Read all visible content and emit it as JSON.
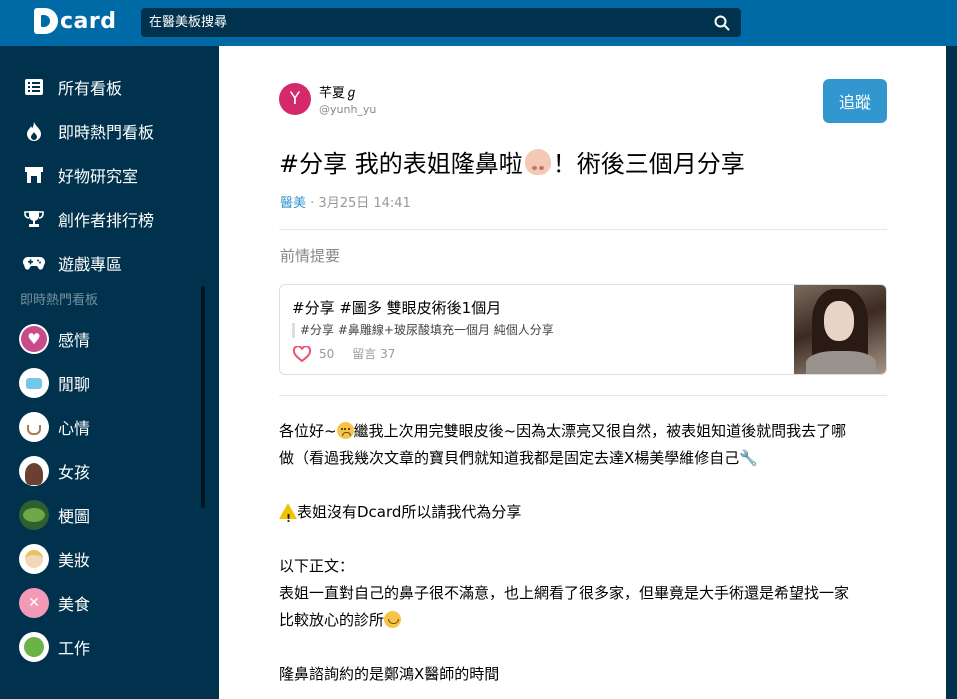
{
  "header": {
    "logo_text": "card",
    "search_placeholder": "在醫美板搜尋",
    "search_icon": "search-icon"
  },
  "sidebar": {
    "nav_items": [
      {
        "label": "所有看板",
        "icon": "list-icon"
      },
      {
        "label": "即時熱門看板",
        "icon": "fire-icon"
      },
      {
        "label": "好物研究室",
        "icon": "store-icon"
      },
      {
        "label": "創作者排行榜",
        "icon": "trophy-icon"
      },
      {
        "label": "遊戲專區",
        "icon": "gamepad-icon"
      }
    ],
    "section_title": "即時熱門看板",
    "boards": [
      {
        "label": "感情",
        "color": "#e05a8a",
        "glyph": "♥"
      },
      {
        "label": "閒聊",
        "color": "#ffffff",
        "glyph": "💬"
      },
      {
        "label": "心情",
        "color": "#ffffff",
        "glyph": "☕"
      },
      {
        "label": "女孩",
        "color": "#ffffff",
        "glyph": "👩"
      },
      {
        "label": "梗圖",
        "color": "#3a7a3a",
        "glyph": "🐸"
      },
      {
        "label": "美妝",
        "color": "#ffffff",
        "glyph": "👧"
      },
      {
        "label": "美食",
        "color": "#f08cb0",
        "glyph": "🍴"
      },
      {
        "label": "工作",
        "color": "#6bb344",
        "glyph": "✎"
      }
    ]
  },
  "post": {
    "author_initial": "Y",
    "author_name": "芊夏ℊ",
    "author_handle": "@yunh_yu",
    "follow_label": "追蹤",
    "title_part1": "#分享 我的表姐隆鼻啦",
    "title_part2": "！術後三個月分享",
    "forum": "醫美",
    "date": "3月25日 14:41",
    "previous_label": "前情提要",
    "linked_card": {
      "title": "#分享 #圖多 雙眼皮術後1個月",
      "excerpt": "#分享 #鼻雕線+玻尿酸填充一個月 純個人分享",
      "likes": "50",
      "comments": "留言 37"
    },
    "body": {
      "line1a": "各位好~",
      "line1b": "繼我上次用完雙眼皮後~因為太漂亮又很自然，被表姐知道後就問我去了哪",
      "line2": "做（看過我幾次文章的寶貝們就知道我都是固定去達X楊美學維修自己",
      "line3": "表姐沒有Dcard所以請我代為分享",
      "line4": "以下正文：",
      "line5": "表姐一直對自己的鼻子很不滿意，也上網看了很多家，但畢竟是大手術還是希望找一家",
      "line6": "比較放心的診所",
      "line7": "隆鼻諮詢約的是鄭鴻X醫師的時間"
    }
  },
  "colors": {
    "topbar": "#006aa6",
    "sidebar": "#00324e",
    "follow_button": "#3397cf",
    "avatar": "#d5296c"
  }
}
